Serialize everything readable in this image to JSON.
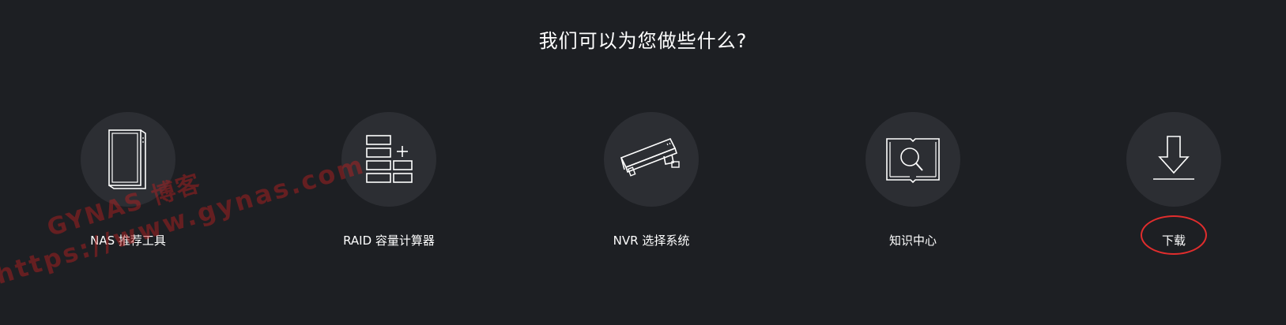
{
  "page": {
    "heading": "我们可以为您做些什么?"
  },
  "tools": [
    {
      "label": "NAS 推荐工具",
      "icon": "nas-tower-icon"
    },
    {
      "label": "RAID 容量计算器",
      "icon": "raid-calculator-icon"
    },
    {
      "label": "NVR 选择系统",
      "icon": "security-camera-icon"
    },
    {
      "label": "知识中心",
      "icon": "knowledge-book-search-icon"
    },
    {
      "label": "下载",
      "icon": "download-arrow-icon"
    }
  ],
  "colors": {
    "background": "#1d1f23",
    "icon_circle": "#2c2e33",
    "text": "#ffffff",
    "highlight_ring": "#e12d2d",
    "watermark": "#be1e1e"
  },
  "watermark": {
    "line1": "GYNAS 博客",
    "line2": "https://www.gynas.com"
  }
}
